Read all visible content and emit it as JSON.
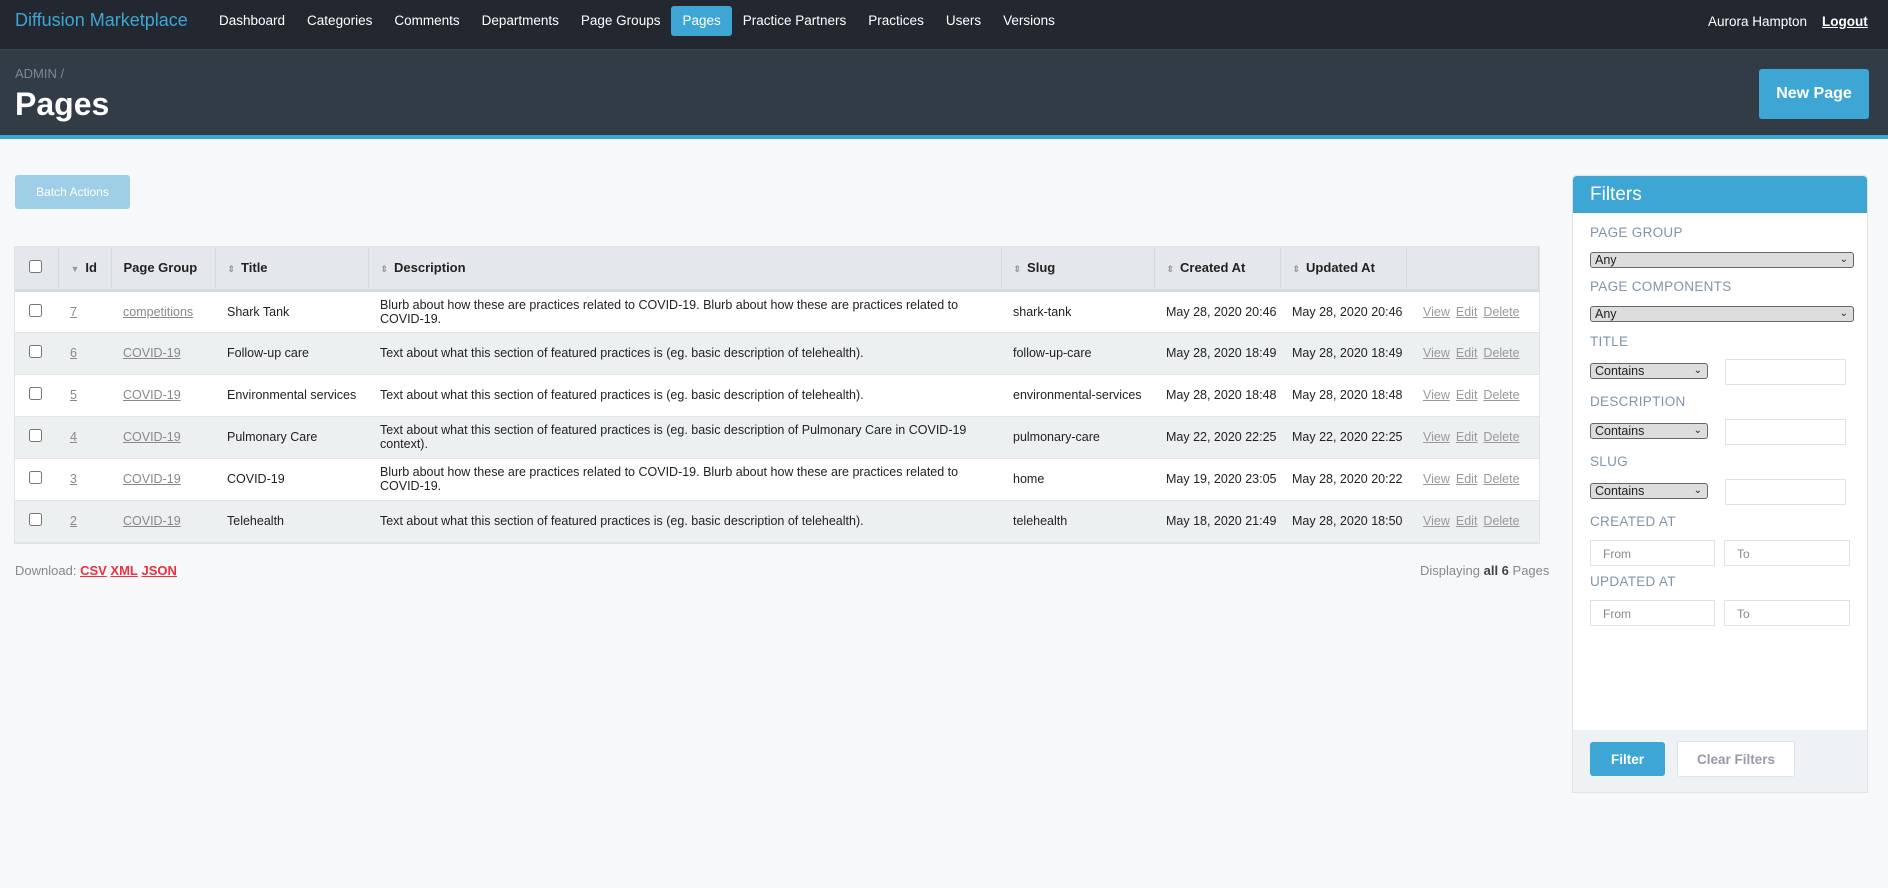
{
  "nav": {
    "brand": "Diffusion Marketplace",
    "items": [
      "Dashboard",
      "Categories",
      "Comments",
      "Departments",
      "Page Groups",
      "Pages",
      "Practice Partners",
      "Practices",
      "Users",
      "Versions"
    ],
    "active": "Pages",
    "user": "Aurora Hampton",
    "logout": "Logout"
  },
  "header": {
    "breadcrumb": "ADMIN /",
    "title": "Pages",
    "new_button": "New Page"
  },
  "batch_actions": "Batch Actions",
  "table": {
    "columns": [
      "Id",
      "Page Group",
      "Title",
      "Description",
      "Slug",
      "Created At",
      "Updated At"
    ],
    "rows": [
      {
        "id": "7",
        "group": "competitions",
        "title": "Shark Tank",
        "description": "Blurb about how these are practices related to COVID-19. Blurb about how these are practices related to COVID-19.",
        "slug": "shark-tank",
        "created": "May 28, 2020 20:46",
        "updated": "May 28, 2020 20:46"
      },
      {
        "id": "6",
        "group": "COVID-19",
        "title": "Follow-up care",
        "description": "Text about what this section of featured practices is (eg. basic description of telehealth).",
        "slug": "follow-up-care",
        "created": "May 28, 2020 18:49",
        "updated": "May 28, 2020 18:49"
      },
      {
        "id": "5",
        "group": "COVID-19",
        "title": "Environmental services",
        "description": "Text about what this section of featured practices is (eg. basic description of telehealth).",
        "slug": "environmental-services",
        "created": "May 28, 2020 18:48",
        "updated": "May 28, 2020 18:48"
      },
      {
        "id": "4",
        "group": "COVID-19",
        "title": "Pulmonary Care",
        "description": "Text about what this section of featured practices is (eg. basic description of Pulmonary Care in COVID-19 context).",
        "slug": "pulmonary-care",
        "created": "May 22, 2020 22:25",
        "updated": "May 22, 2020 22:25"
      },
      {
        "id": "3",
        "group": "COVID-19",
        "title": "COVID-19",
        "description": "Blurb about how these are practices related to COVID-19. Blurb about how these are practices related to COVID-19.",
        "slug": "home",
        "created": "May 19, 2020 23:05",
        "updated": "May 28, 2020 20:22"
      },
      {
        "id": "2",
        "group": "COVID-19",
        "title": "Telehealth",
        "description": "Text about what this section of featured practices is (eg. basic description of telehealth).",
        "slug": "telehealth",
        "created": "May 18, 2020 21:49",
        "updated": "May 28, 2020 18:50"
      }
    ],
    "actions": [
      "View",
      "Edit",
      "Delete"
    ]
  },
  "footer": {
    "download_label": "Download:",
    "formats": [
      "CSV",
      "XML",
      "JSON"
    ],
    "display_prefix": "Displaying",
    "display_bold": "all 6",
    "display_suffix": "Pages"
  },
  "filters": {
    "title": "Filters",
    "page_group_label": "PAGE GROUP",
    "page_group_value": "Any",
    "components_label": "PAGE COMPONENTS",
    "components_value": "Any",
    "title_label": "TITLE",
    "description_label": "DESCRIPTION",
    "slug_label": "SLUG",
    "match_value": "Contains",
    "created_label": "CREATED AT",
    "updated_label": "UPDATED AT",
    "from_placeholder": "From",
    "to_placeholder": "To",
    "filter_button": "Filter",
    "clear_button": "Clear Filters"
  },
  "colors": {
    "accent": "#3ea6d4",
    "nav_bg": "#232830",
    "header_bg": "#323c47",
    "download_link": "#e8323c"
  }
}
